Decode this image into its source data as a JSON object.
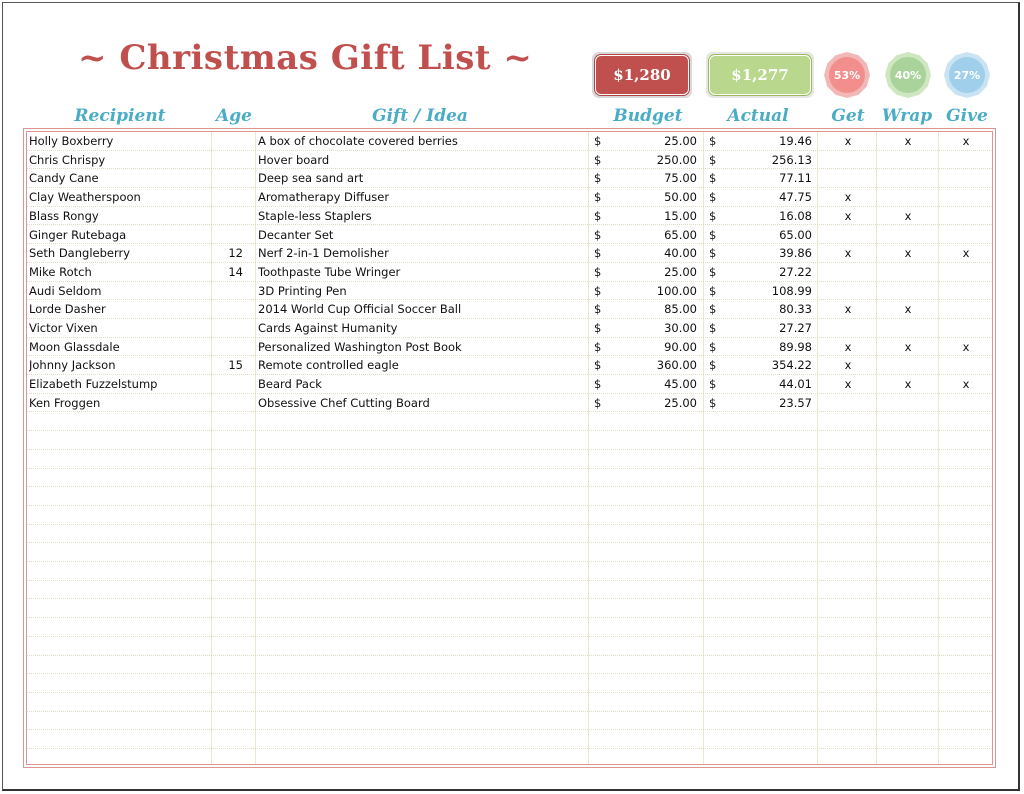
{
  "title": "~ Christmas Gift List ~",
  "summary": {
    "budget_total": "$1,280",
    "actual_total": "$1,277",
    "get_pct": "53%",
    "wrap_pct": "40%",
    "give_pct": "27%"
  },
  "columns": {
    "recipient": "Recipient",
    "age": "Age",
    "gift": "Gift / Idea",
    "budget": "Budget",
    "actual": "Actual",
    "get": "Get",
    "wrap": "Wrap",
    "give": "Give"
  },
  "currency_symbol": "$",
  "rows": [
    {
      "recipient": "Holly Boxberry",
      "age": "",
      "gift": "A box of chocolate covered berries",
      "budget": "25.00",
      "actual": "19.46",
      "get": "x",
      "wrap": "x",
      "give": "x"
    },
    {
      "recipient": "Chris Chrispy",
      "age": "",
      "gift": "Hover board",
      "budget": "250.00",
      "actual": "256.13",
      "get": "",
      "wrap": "",
      "give": ""
    },
    {
      "recipient": "Candy Cane",
      "age": "",
      "gift": "Deep sea sand art",
      "budget": "75.00",
      "actual": "77.11",
      "get": "",
      "wrap": "",
      "give": ""
    },
    {
      "recipient": "Clay Weatherspoon",
      "age": "",
      "gift": "Aromatherapy Diffuser",
      "budget": "50.00",
      "actual": "47.75",
      "get": "x",
      "wrap": "",
      "give": ""
    },
    {
      "recipient": "Blass Rongy",
      "age": "",
      "gift": "Staple-less Staplers",
      "budget": "15.00",
      "actual": "16.08",
      "get": "x",
      "wrap": "x",
      "give": ""
    },
    {
      "recipient": "Ginger Rutebaga",
      "age": "",
      "gift": "Decanter Set",
      "budget": "65.00",
      "actual": "65.00",
      "get": "",
      "wrap": "",
      "give": ""
    },
    {
      "recipient": "Seth Dangleberry",
      "age": "12",
      "gift": "Nerf 2-in-1 Demolisher",
      "budget": "40.00",
      "actual": "39.86",
      "get": "x",
      "wrap": "x",
      "give": "x"
    },
    {
      "recipient": "Mike Rotch",
      "age": "14",
      "gift": "Toothpaste Tube Wringer",
      "budget": "25.00",
      "actual": "27.22",
      "get": "",
      "wrap": "",
      "give": ""
    },
    {
      "recipient": "Audi Seldom",
      "age": "",
      "gift": "3D Printing Pen",
      "budget": "100.00",
      "actual": "108.99",
      "get": "",
      "wrap": "",
      "give": ""
    },
    {
      "recipient": "Lorde Dasher",
      "age": "",
      "gift": "2014 World Cup Official Soccer Ball",
      "budget": "85.00",
      "actual": "80.33",
      "get": "x",
      "wrap": "x",
      "give": ""
    },
    {
      "recipient": "Victor Vixen",
      "age": "",
      "gift": "Cards Against Humanity",
      "budget": "30.00",
      "actual": "27.27",
      "get": "",
      "wrap": "",
      "give": ""
    },
    {
      "recipient": "Moon Glassdale",
      "age": "",
      "gift": "Personalized Washington Post Book",
      "budget": "90.00",
      "actual": "89.98",
      "get": "x",
      "wrap": "x",
      "give": "x"
    },
    {
      "recipient": "Johnny Jackson",
      "age": "15",
      "gift": "Remote controlled eagle",
      "budget": "360.00",
      "actual": "354.22",
      "get": "x",
      "wrap": "",
      "give": ""
    },
    {
      "recipient": "Elizabeth Fuzzelstump",
      "age": "",
      "gift": "Beard Pack",
      "budget": "45.00",
      "actual": "44.01",
      "get": "x",
      "wrap": "x",
      "give": "x"
    },
    {
      "recipient": "Ken Froggen",
      "age": "",
      "gift": "Obsessive Chef Cutting Board",
      "budget": "25.00",
      "actual": "23.57",
      "get": "",
      "wrap": "",
      "give": ""
    }
  ],
  "colors": {
    "title": "#c0504d",
    "header": "#4bacc6",
    "budget_box": "#c0504d",
    "actual_box": "#b9d78d",
    "get_badge": "#f28f8d",
    "wrap_badge": "#a9d39a",
    "give_badge": "#9fcfea",
    "table_border": "#d99694"
  }
}
